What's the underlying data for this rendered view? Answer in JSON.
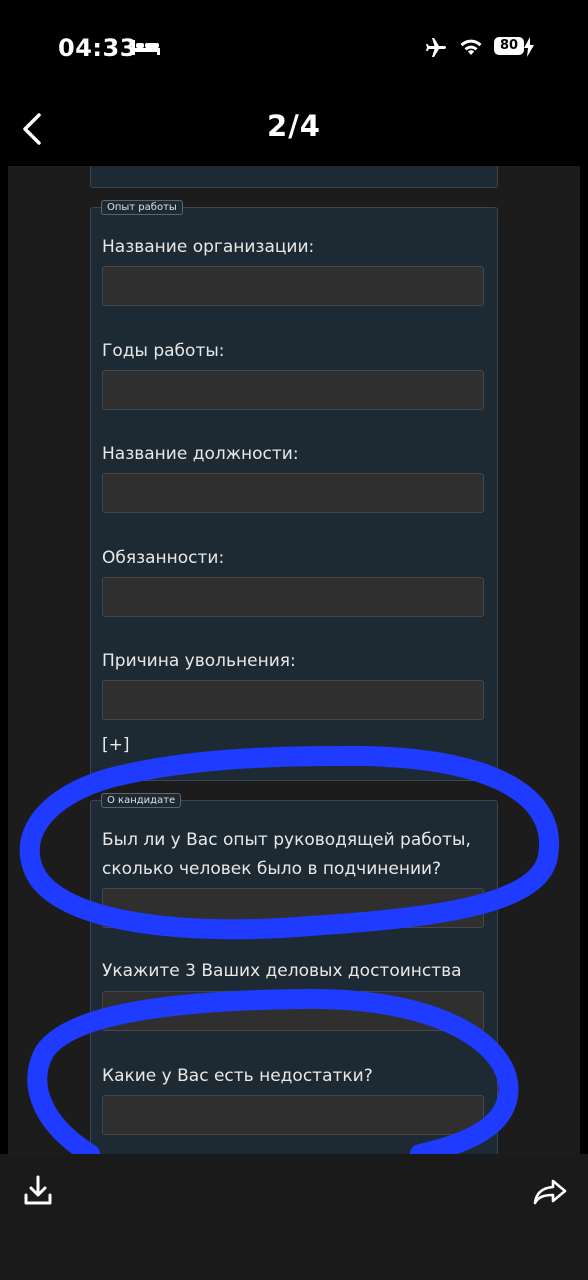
{
  "status_bar": {
    "time": "04:33",
    "battery_level": "80",
    "icons": [
      "bed-icon",
      "airplane-icon",
      "wifi-icon",
      "battery-icon",
      "bolt-icon"
    ]
  },
  "nav": {
    "title": "2/4",
    "back_icon": "chevron-left-icon"
  },
  "form": {
    "experience": {
      "legend": "Опыт работы",
      "fields": [
        {
          "label": "Название организации:",
          "value": ""
        },
        {
          "label": "Годы работы:",
          "value": ""
        },
        {
          "label": "Название должности:",
          "value": ""
        },
        {
          "label": "Обязанности:",
          "value": ""
        },
        {
          "label": "Причина увольнения:",
          "value": ""
        }
      ],
      "add_label": "[+]"
    },
    "candidate": {
      "legend": "О кандидате",
      "fields": [
        {
          "label_line1": "Был ли у Вас опыт руководящей работы,",
          "label_line2": "сколько человек было в подчинении?",
          "value": ""
        },
        {
          "label": "Укажите 3 Ваших деловых достоинства",
          "value": ""
        },
        {
          "label": "Какие у Вас есть недостатки?",
          "value": ""
        }
      ]
    }
  },
  "annotations": {
    "stroke_color": "#1f3bff"
  },
  "bottom_bar": {
    "icons": [
      "download-icon",
      "share-icon"
    ]
  }
}
